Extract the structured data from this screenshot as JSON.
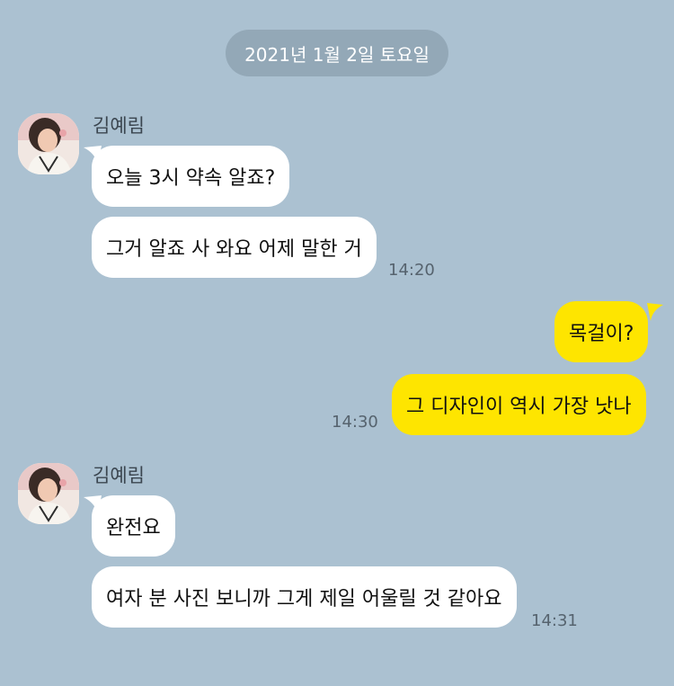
{
  "chat": {
    "date_divider": "2021년 1월 2일 토요일",
    "groups": [
      {
        "sender": "김예림",
        "messages": [
          "오늘 3시 약속 알죠?",
          "그거 알죠 사 와요 어제 말한 거"
        ],
        "time": "14:20"
      },
      {
        "sender": "",
        "messages": [
          "목걸이?",
          "그 디자인이 역시 가장 낫나"
        ],
        "time": "14:30"
      },
      {
        "sender": "김예림",
        "messages": [
          "완전요",
          "여자 분 사진 보니까 그게 제일 어울릴 것 같아요"
        ],
        "time": "14:31"
      }
    ]
  },
  "colors": {
    "background": "#abc1d1",
    "incoming_bubble": "#ffffff",
    "outgoing_bubble": "#fee500",
    "date_pill": "#93a8b7"
  },
  "icons": {
    "avatar": "profile-photo-avatar"
  }
}
